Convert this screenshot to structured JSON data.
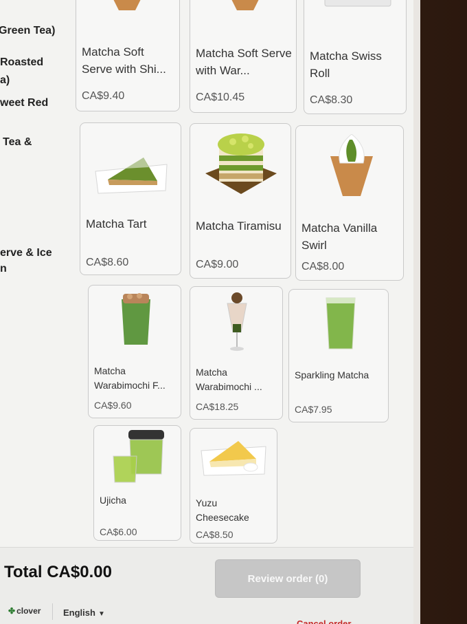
{
  "sidebar": {
    "categories": [
      "Green Tea)",
      "Roasted",
      "a)",
      "weet Red",
      "Tea &",
      "erve & Ice",
      "n"
    ]
  },
  "items": [
    {
      "name": "Matcha Soft Serve with Shi...",
      "price": "CA$9.40"
    },
    {
      "name": "Matcha Soft Serve with War...",
      "price": "CA$10.45"
    },
    {
      "name": "Matcha Swiss Roll",
      "price": "CA$8.30"
    },
    {
      "name": "Matcha Tart",
      "price": "CA$8.60"
    },
    {
      "name": "Matcha Tiramisu",
      "price": "CA$9.00"
    },
    {
      "name": "Matcha Vanilla Swirl",
      "price": "CA$8.00"
    },
    {
      "name": "Matcha Warabimochi F...",
      "price": "CA$9.60"
    },
    {
      "name": "Matcha Warabimochi ...",
      "price": "CA$18.25"
    },
    {
      "name": "Sparkling Matcha",
      "price": "CA$7.95"
    },
    {
      "name": "Ujicha",
      "price": "CA$6.00"
    },
    {
      "name": "Yuzu Cheesecake",
      "price": "CA$8.50"
    }
  ],
  "footer": {
    "total": "Total CA$0.00",
    "review_button": "Review order (0)",
    "brand": "clover",
    "language": "English",
    "cancel": "Cancel order"
  },
  "colors": {
    "accent": "#2e7d32",
    "button_disabled": "#c6c6c6",
    "cancel": "#c62828"
  }
}
